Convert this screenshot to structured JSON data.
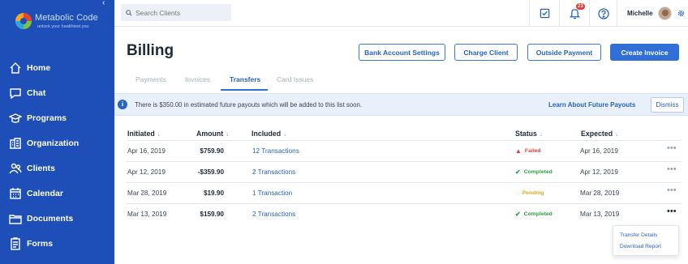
{
  "brand": {
    "name": "Metabolic Code",
    "tagline": "unlock your healthiest you",
    "sidebar_color": "#1e4fb8",
    "accent": "#2f6fd6"
  },
  "sidebar": {
    "items": [
      {
        "label": "Home",
        "icon": "home-icon"
      },
      {
        "label": "Chat",
        "icon": "chat-icon"
      },
      {
        "label": "Programs",
        "icon": "graduation-cap-icon"
      },
      {
        "label": "Organization",
        "icon": "building-icon"
      },
      {
        "label": "Clients",
        "icon": "users-icon"
      },
      {
        "label": "Calendar",
        "icon": "calendar-icon"
      },
      {
        "label": "Documents",
        "icon": "folder-icon"
      },
      {
        "label": "Forms",
        "icon": "clipboard-icon"
      }
    ]
  },
  "topbar": {
    "search_placeholder": "Search Clients",
    "notification_count": "23",
    "user_name": "Michelle"
  },
  "page": {
    "title": "Billing",
    "buttons": {
      "bank_account_settings": "Bank Account Settings",
      "charge_client": "Charge Client",
      "outside_payment": "Outside Payment",
      "create_invoice": "Create Invoice"
    },
    "tabs": [
      "Payments",
      "Invoices",
      "Transfers",
      "Card Issues"
    ],
    "active_tab": "Transfers"
  },
  "banner": {
    "text": "There is $350.00 in estimated future payouts which will be added to this list soon.",
    "link": "Learn About Future Payouts",
    "dismiss": "Dismiss"
  },
  "table": {
    "columns": [
      "Initiated",
      "Amount",
      "Included",
      "Status",
      "Expected"
    ],
    "rows": [
      {
        "initiated": "Apr 16, 2019",
        "amount": "$759.90",
        "included": "12 Transactions",
        "status": "Failed",
        "expected": "Apr 16, 2019"
      },
      {
        "initiated": "Apr 12, 2019",
        "amount": "-$359.90",
        "included": "2 Transactions",
        "status": "Completed",
        "expected": "Apr 12, 2019"
      },
      {
        "initiated": "Mar 28, 2019",
        "amount": "$19.90",
        "included": "1 Transaction",
        "status": "Pending",
        "expected": "Mar 28, 2019"
      },
      {
        "initiated": "Mar 13, 2019",
        "amount": "$159.90",
        "included": "2 Transactions",
        "status": "Completed",
        "expected": "Mar 13, 2019"
      }
    ],
    "status_colors": {
      "Failed": "#e53935",
      "Completed": "#2e9e46",
      "Pending": "#f0a81c"
    }
  },
  "row_menu": {
    "items": [
      "Transfer Details",
      "Download Report"
    ]
  }
}
